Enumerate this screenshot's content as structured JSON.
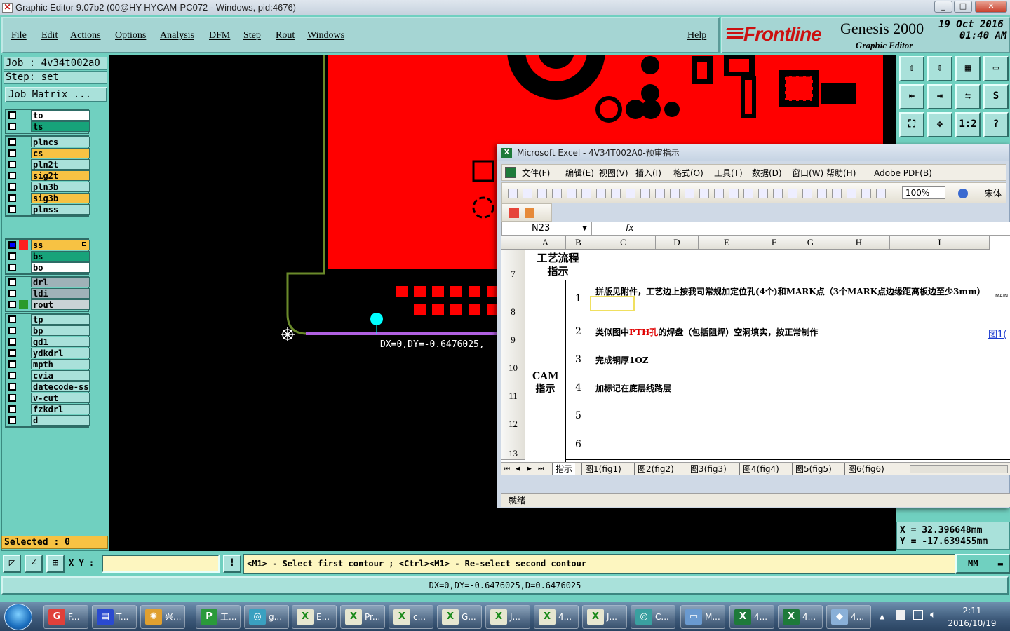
{
  "titlebar": {
    "title": "Graphic Editor 9.07b2 (00@HY-HYCAM-PC072 - Windows, pid:4676)",
    "min": "_",
    "max": "□",
    "close": "✕"
  },
  "menu": {
    "file": "File",
    "edit": "Edit",
    "actions": "Actions",
    "options": "Options",
    "analysis": "Analysis",
    "dfm": "DFM",
    "step": "Step",
    "rout": "Rout",
    "windows": "Windows",
    "help": "Help"
  },
  "brand": {
    "logo": "Frontline",
    "product": "Genesis 2000",
    "subtitle": "Graphic Editor",
    "date": "19 Oct 2016",
    "time": "01:40 AM"
  },
  "job": {
    "job_line": "Job : 4v34t002a0",
    "step_line": "Step: set",
    "matrix_button": "Job Matrix ..."
  },
  "layers": {
    "group1": [
      {
        "name": "to",
        "bg": "#ffffff"
      },
      {
        "name": "ts",
        "bg": "#17a37a"
      }
    ],
    "group2": [
      {
        "name": "plncs",
        "bg": "#a9e1da"
      },
      {
        "name": "cs",
        "bg": "#f7c243"
      },
      {
        "name": "pln2t",
        "bg": "#a9e1da"
      },
      {
        "name": "sig2t",
        "bg": "#f7c243"
      },
      {
        "name": "pln3b",
        "bg": "#a9e1da"
      },
      {
        "name": "sig3b",
        "bg": "#f7c243"
      },
      {
        "name": "plnss",
        "bg": "#a9e1da"
      }
    ],
    "group3": [
      {
        "name": "ss",
        "bg": "#f7c243",
        "active": true,
        "swatch": "#ff2020"
      },
      {
        "name": "bs",
        "bg": "#17a37a"
      },
      {
        "name": "bo",
        "bg": "#ffffff"
      }
    ],
    "group4": [
      {
        "name": "drl",
        "bg": "#9fb2b8"
      },
      {
        "name": "ldi",
        "bg": "#9fb2b8"
      },
      {
        "name": "rout",
        "bg": "#c9d3d6",
        "swatch": "#2a9a2a"
      }
    ],
    "group5": [
      {
        "name": "tp",
        "bg": "#a9e1da"
      },
      {
        "name": "bp",
        "bg": "#a9e1da"
      },
      {
        "name": "gd1",
        "bg": "#a9e1da"
      },
      {
        "name": "ydkdrl",
        "bg": "#a9e1da"
      },
      {
        "name": "mpth",
        "bg": "#a9e1da"
      },
      {
        "name": "cvia",
        "bg": "#a9e1da"
      },
      {
        "name": "datecode-ss",
        "bg": "#a9e1da"
      },
      {
        "name": "v-cut",
        "bg": "#a9e1da"
      },
      {
        "name": "fzkdrl",
        "bg": "#a9e1da"
      },
      {
        "name": "d",
        "bg": "#a9e1da"
      }
    ]
  },
  "selected": "Selected : 0",
  "canvas": {
    "measure_label": "DX=0,DY=-0.6476025,"
  },
  "coords": {
    "x": "X = 32.396648mm",
    "y": "Y = -17.639455mm"
  },
  "toolbar_icons": [
    "home-icon",
    "layer-down-icon",
    "screen-icon",
    "window-icon",
    "pan-left-icon",
    "pan-right-icon",
    "flip-icon",
    "s-shape-icon",
    "fit-icon",
    "center-icon",
    "ratio-icon",
    "help-icon"
  ],
  "toolbar_glyphs": [
    "⇧",
    "⇩",
    "▦",
    "▭",
    "⇤",
    "⇥",
    "⇋",
    "S",
    "⛶",
    "✥",
    "1:2",
    "?"
  ],
  "bottom": {
    "xy_label": "X Y :",
    "warn": "!",
    "prompt": "<M1> - Select first contour ; <Ctrl><M1> - Re-select second contour",
    "unit": "MM"
  },
  "status_line": "DX=0,DY=-0.6476025,D=0.6476025",
  "excel": {
    "title": "Microsoft Excel - 4V34T002A0-预审指示",
    "menu": [
      "文件(F)",
      "编辑(E)",
      "视图(V)",
      "插入(I)",
      "格式(O)",
      "工具(T)",
      "数据(D)",
      "窗口(W)",
      "帮助(H)",
      "Adobe PDF(B)"
    ],
    "zoom": "100%",
    "font": "宋体",
    "namebox": "N23",
    "fx": "fx",
    "columns": [
      "A",
      "B",
      "C",
      "D",
      "E",
      "F",
      "G",
      "H",
      "I"
    ],
    "rows": [
      "7",
      "8",
      "9",
      "10",
      "11",
      "12",
      "13"
    ],
    "header_cell": "工艺流程指示",
    "section_label": "CAM指示",
    "items": [
      {
        "num": "1",
        "text": "拼版见附件，工艺边上按我司常规加定位孔(4个)和MARK点（3个MARK点边缘距离板边至少3mm）"
      },
      {
        "num": "2",
        "text_a": "类似图中",
        "text_red": "PTH孔",
        "text_b": "的焊盘（包括阻焊）空洞填实，按正常制作",
        "link": "图1("
      },
      {
        "num": "3",
        "text": "完成铜厚1OZ"
      },
      {
        "num": "4",
        "text": "加标记在底层线路层"
      },
      {
        "num": "5",
        "text": ""
      },
      {
        "num": "6",
        "text": ""
      }
    ],
    "side_note": "MAIN",
    "tabs": [
      "指示",
      "图1(fig1)",
      "图2(fig2)",
      "图3(fig3)",
      "图4(fig4)",
      "图5(fig5)",
      "图6(fig6)"
    ],
    "status": "就绪"
  },
  "taskbar": {
    "tasks": [
      {
        "label": "F...",
        "icon": "G",
        "color": "#e0403a"
      },
      {
        "label": "T...",
        "icon": "▤",
        "color": "#2a4ad0"
      },
      {
        "label": "兴...",
        "icon": "✺",
        "color": "#e0a030"
      },
      {
        "label": "工...",
        "icon": "P",
        "color": "#2a9a3a"
      },
      {
        "label": "g...",
        "icon": "◎",
        "color": "#3aa0c0"
      },
      {
        "label": "E...",
        "icon": "X",
        "color": "#e6e6d0"
      },
      {
        "label": "Pr...",
        "icon": "X",
        "color": "#e6e6d0"
      },
      {
        "label": "c...",
        "icon": "X",
        "color": "#e6e6d0"
      },
      {
        "label": "G...",
        "icon": "X",
        "color": "#e6e6d0"
      },
      {
        "label": "J...",
        "icon": "X",
        "color": "#e6e6d0"
      },
      {
        "label": "4...",
        "icon": "X",
        "color": "#e6e6d0"
      },
      {
        "label": "J...",
        "icon": "X",
        "color": "#e6e6d0"
      },
      {
        "label": "C...",
        "icon": "◎",
        "color": "#3aa0a0"
      },
      {
        "label": "M...",
        "icon": "▭",
        "color": "#6a9ad0"
      },
      {
        "label": "4...",
        "icon": "X",
        "color": "#1e7a3a"
      },
      {
        "label": "4...",
        "icon": "X",
        "color": "#1e7a3a"
      },
      {
        "label": "4...",
        "icon": "◆",
        "color": "#8ab0d8"
      }
    ],
    "time": "2:11",
    "date": "2016/10/19"
  }
}
